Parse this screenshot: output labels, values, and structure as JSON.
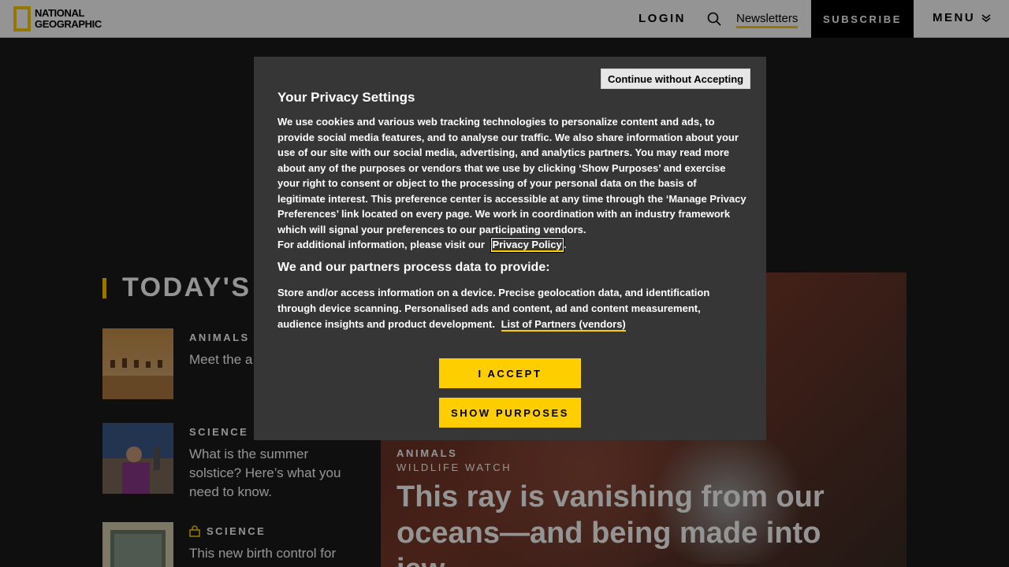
{
  "header": {
    "logo_line1": "National",
    "logo_line2": "Geographic",
    "login": "LOGIN",
    "newsletters": "Newsletters",
    "subscribe": "SUBSCRIBE",
    "menu": "MENU"
  },
  "page": {
    "section_heading": "TODAY'S",
    "stories": [
      {
        "category": "ANIMALS",
        "title": "Meet the a handle ext"
      },
      {
        "category": "SCIENCE",
        "title": "What is the summer solstice? Here’s what you need to know."
      },
      {
        "category": "SCIENCE",
        "title": "This new birth control for"
      }
    ],
    "hero": {
      "category": "ANIMALS",
      "subcategory": "WILDLIFE WATCH",
      "title": "This ray is vanishing from our oceans—and being made into jew..."
    }
  },
  "dialog": {
    "continue_label": "Continue without Accepting",
    "title": "Your Privacy Settings",
    "body": "We use cookies and various web tracking technologies to personalize content and ads, to provide social media features, and to analyse our traffic. We also share information about your use of our site with our social media, advertising, and analytics partners. You may read more about any of the purposes or vendors that we use by clicking ‘Show Purposes’ and exercise your right to consent or object to the processing of your personal data on the basis of legitimate interest. This preference center is accessible at any time through the ‘Manage Privacy Preferences’ link located on every page. We work in coordination with an industry framework which will signal your preferences to our participating vendors.",
    "additional_info": "For additional information, please visit our",
    "privacy_policy_link": "Privacy Policy",
    "period": ".",
    "subheading": "We and our partners process data to provide:",
    "purposes": "Store and/or access information on a device. Precise geolocation data, and identification through device scanning. Personalised ads and content, ad and content measurement, audience insights and product development.",
    "vendors_link": "List of Partners (vendors)",
    "accept_label": "I ACCEPT",
    "show_purposes_label": "SHOW PURPOSES"
  },
  "colors": {
    "accent_yellow": "#ffce00",
    "dialog_bg": "#363636"
  }
}
